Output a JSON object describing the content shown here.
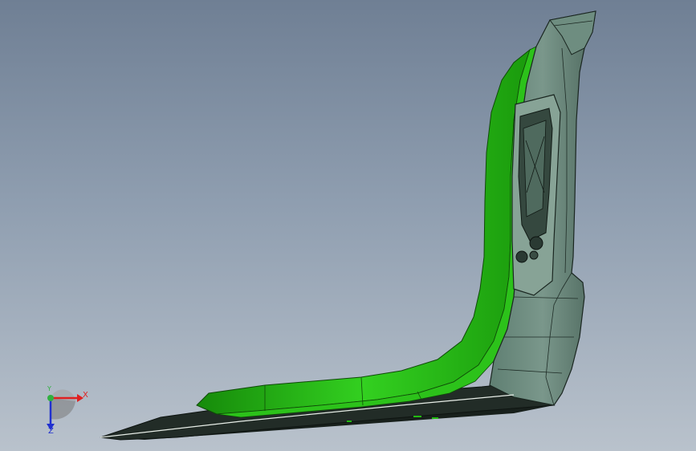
{
  "viewport": {
    "background_top": "#6f7f94",
    "background_bottom": "#b9c2cc"
  },
  "model": {
    "highlight_color": "#22bb10",
    "body_color": "#6b8a7c",
    "edge_color": "#1a2620"
  },
  "triad": {
    "x_label": "X",
    "y_label": "Y",
    "z_label": "Z",
    "x_color": "#e02020",
    "y_color": "#30b040",
    "z_color": "#2030d0"
  }
}
